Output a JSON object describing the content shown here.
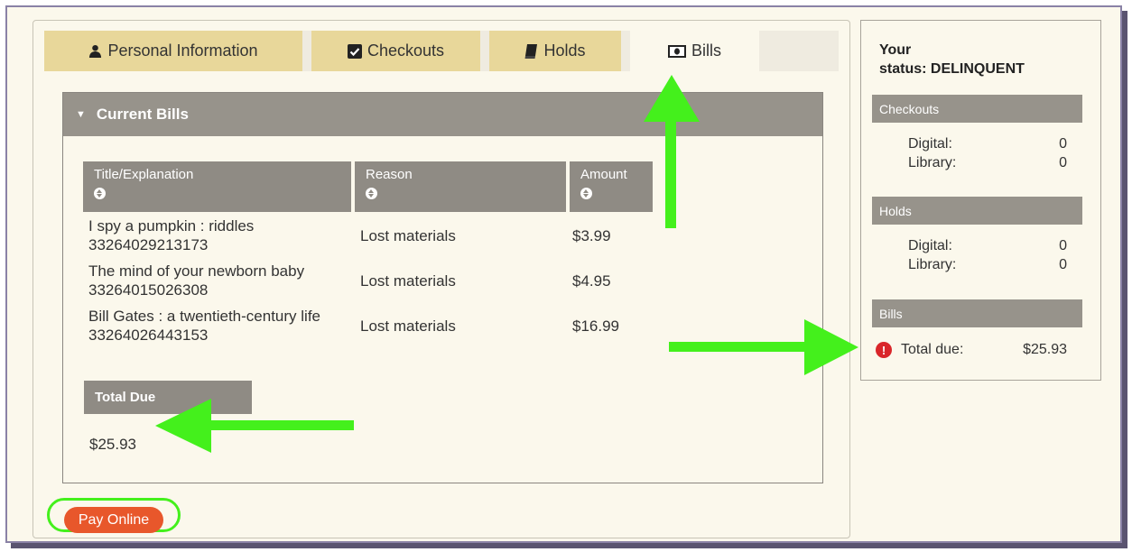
{
  "tabs": [
    {
      "label": "Personal Information",
      "icon": "user-icon"
    },
    {
      "label": "Checkouts",
      "icon": "checkbox-icon"
    },
    {
      "label": "Holds",
      "icon": "book-icon"
    },
    {
      "label": "Bills",
      "icon": "money-icon"
    }
  ],
  "active_tab": "Bills",
  "bills": {
    "header": "Current Bills",
    "columns": [
      "Title/Explanation",
      "Reason",
      "Amount"
    ],
    "rows": [
      {
        "title": "I spy a pumpkin : riddles",
        "barcode": "33264029213173",
        "reason": "Lost materials",
        "amount": "$3.99"
      },
      {
        "title": "The mind of your newborn baby",
        "barcode": "33264015026308",
        "reason": "Lost materials",
        "amount": "$4.95"
      },
      {
        "title": "Bill Gates : a twentieth-century life",
        "barcode": "33264026443153",
        "reason": "Lost materials",
        "amount": "$16.99"
      }
    ],
    "total_label": "Total Due",
    "total_value": "$25.93",
    "pay_button": "Pay Online"
  },
  "status": {
    "title_line1": "Your",
    "title_line2": "status: DELINQUENT",
    "checkouts": {
      "heading": "Checkouts",
      "digital_label": "Digital:",
      "digital": "0",
      "library_label": "Library:",
      "library": "0"
    },
    "holds": {
      "heading": "Holds",
      "digital_label": "Digital:",
      "digital": "0",
      "library_label": "Library:",
      "library": "0"
    },
    "bills": {
      "heading": "Bills",
      "total_label": "Total due:",
      "total": "$25.93"
    }
  },
  "colors": {
    "tab": "#e8d79a",
    "panel_bg": "#fbf8ec",
    "header_gray": "#97938b",
    "pay_button": "#e8572b",
    "annotation_green": "#44f01c",
    "alert_red": "#d9262a"
  }
}
